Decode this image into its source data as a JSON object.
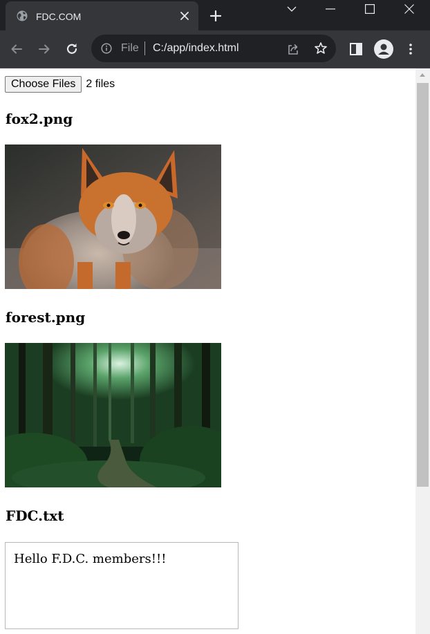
{
  "browser": {
    "tab": {
      "title": "FDC.COM",
      "favicon": "globe-icon"
    },
    "address_bar": {
      "scheme_label": "File",
      "url": "C:/app/index.html"
    },
    "window_controls": [
      "chevron-down-icon",
      "minimize-icon",
      "maximize-icon",
      "close-icon"
    ]
  },
  "page": {
    "file_input": {
      "button_label": "Choose Files",
      "status": "2 files"
    },
    "files": [
      {
        "name": "fox2.png",
        "kind": "image",
        "image": "fox portrait"
      },
      {
        "name": "forest.png",
        "kind": "image",
        "image": "forest path"
      },
      {
        "name": "FDC.txt",
        "kind": "text",
        "content": "Hello F.D.C. members!!!"
      }
    ]
  },
  "colors": {
    "tabstrip": "#202124",
    "toolbar": "#35363a",
    "page_bg": "#ffffff"
  }
}
